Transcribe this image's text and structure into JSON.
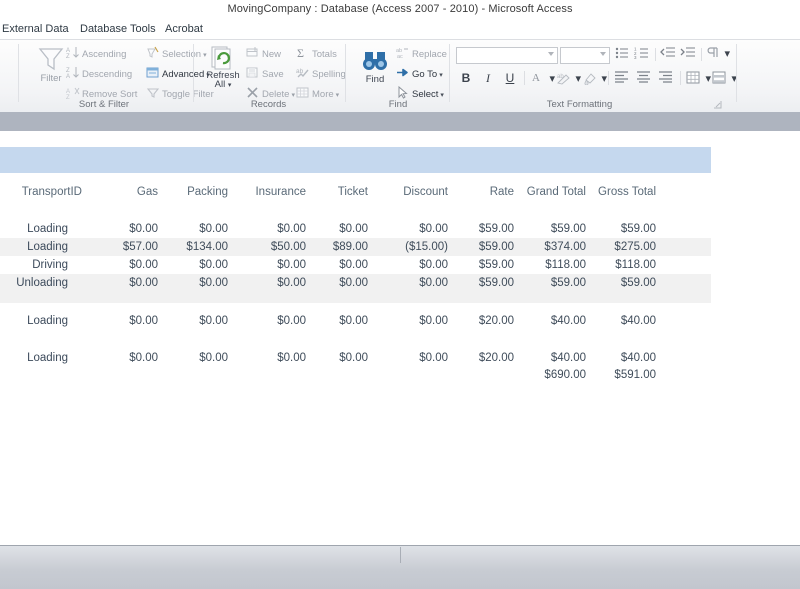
{
  "window": {
    "title": "MovingCompany : Database (Access 2007 - 2010)  -  Microsoft Access"
  },
  "ribbon": {
    "tabs": [
      {
        "label": "External Data",
        "active": false
      },
      {
        "label": "Database Tools",
        "active": false
      },
      {
        "label": "Acrobat",
        "active": false
      }
    ],
    "groups": [
      {
        "name": "Sort & Filter",
        "label": "Sort & Filter",
        "big": [
          {
            "label": "Filter",
            "icon": "funnel-icon",
            "enabled": false
          }
        ],
        "items": [
          {
            "label": "Ascending",
            "icon": "sort-ascending-icon",
            "enabled": false,
            "dropdown": false
          },
          {
            "label": "Descending",
            "icon": "sort-descending-icon",
            "enabled": false,
            "dropdown": false
          },
          {
            "label": "Remove Sort",
            "icon": "remove-sort-icon",
            "enabled": false,
            "dropdown": false
          },
          {
            "label": "Selection",
            "icon": "selection-icon",
            "enabled": false,
            "dropdown": true
          },
          {
            "label": "Advanced",
            "icon": "advanced-filter-icon",
            "enabled": true,
            "dropdown": true
          },
          {
            "label": "Toggle Filter",
            "icon": "toggle-filter-icon",
            "enabled": false,
            "dropdown": false
          }
        ]
      },
      {
        "name": "Records",
        "label": "Records",
        "big": [
          {
            "label": "Refresh All",
            "icon": "refresh-all-icon",
            "enabled": true
          }
        ],
        "items": [
          {
            "label": "New",
            "icon": "new-record-icon",
            "enabled": false,
            "dropdown": false
          },
          {
            "label": "Save",
            "icon": "save-record-icon",
            "enabled": false,
            "dropdown": false
          },
          {
            "label": "Delete",
            "icon": "delete-record-icon",
            "enabled": false,
            "dropdown": true
          },
          {
            "label": "Totals",
            "icon": "sigma-totals-icon",
            "enabled": false,
            "dropdown": false
          },
          {
            "label": "Spelling",
            "icon": "spelling-icon",
            "enabled": false,
            "dropdown": false
          },
          {
            "label": "More",
            "icon": "more-icon",
            "enabled": false,
            "dropdown": true
          }
        ]
      },
      {
        "name": "Find",
        "label": "Find",
        "big": [
          {
            "label": "Find",
            "icon": "binoculars-find-icon",
            "enabled": true
          }
        ],
        "items": [
          {
            "label": "Replace",
            "icon": "replace-icon",
            "enabled": false,
            "dropdown": false
          },
          {
            "label": "Go To",
            "icon": "go-to-icon",
            "enabled": true,
            "dropdown": true
          },
          {
            "label": "Select",
            "icon": "select-icon",
            "enabled": true,
            "dropdown": true
          }
        ]
      },
      {
        "name": "Text Formatting",
        "label": "Text Formatting",
        "font_name": "",
        "font_size": "",
        "buttons": [
          {
            "name": "bullets-icon",
            "glyph": "bullets"
          },
          {
            "name": "numbering-icon",
            "glyph": "numbering"
          },
          {
            "name": "decrease-indent-icon",
            "glyph": "outdent"
          },
          {
            "name": "increase-indent-icon",
            "glyph": "indent"
          },
          {
            "name": "text-direction-icon",
            "glyph": "rtl"
          },
          {
            "name": "bold-icon",
            "glyph": "B"
          },
          {
            "name": "italic-icon",
            "glyph": "I"
          },
          {
            "name": "underline-icon",
            "glyph": "U"
          },
          {
            "name": "font-color-icon",
            "glyph": "A"
          },
          {
            "name": "text-highlight-icon",
            "glyph": "highlight"
          },
          {
            "name": "background-color-icon",
            "glyph": "fill"
          },
          {
            "name": "align-left-icon",
            "glyph": "align-left"
          },
          {
            "name": "align-center-icon",
            "glyph": "align-center"
          },
          {
            "name": "align-right-icon",
            "glyph": "align-right"
          },
          {
            "name": "gridlines-icon",
            "glyph": "grid"
          },
          {
            "name": "alternate-fill-color-icon",
            "glyph": "altfill"
          }
        ]
      }
    ]
  },
  "report": {
    "columns": [
      {
        "key": "transport_id",
        "label": "TransportID",
        "align": "right"
      },
      {
        "key": "gas",
        "label": "Gas",
        "align": "right"
      },
      {
        "key": "packing",
        "label": "Packing",
        "align": "right"
      },
      {
        "key": "insurance",
        "label": "Insurance",
        "align": "right"
      },
      {
        "key": "ticket",
        "label": "Ticket",
        "align": "right"
      },
      {
        "key": "discount",
        "label": "Discount",
        "align": "right"
      },
      {
        "key": "rate",
        "label": "Rate",
        "align": "right"
      },
      {
        "key": "grand_total",
        "label": "Grand Total",
        "align": "right"
      },
      {
        "key": "gross_total",
        "label": "Gross Total",
        "align": "right"
      }
    ],
    "rows": [
      {
        "transport_id": "Loading",
        "gas": "$0.00",
        "packing": "$0.00",
        "insurance": "$0.00",
        "ticket": "$0.00",
        "discount": "$0.00",
        "rate": "$59.00",
        "grand_total": "$59.00",
        "gross_total": "$59.00",
        "shaded": false
      },
      {
        "transport_id": "Loading",
        "gas": "$57.00",
        "packing": "$134.00",
        "insurance": "$50.00",
        "ticket": "$89.00",
        "discount": "($15.00)",
        "rate": "$59.00",
        "grand_total": "$374.00",
        "gross_total": "$275.00",
        "shaded": true
      },
      {
        "transport_id": "Driving",
        "gas": "$0.00",
        "packing": "$0.00",
        "insurance": "$0.00",
        "ticket": "$0.00",
        "discount": "$0.00",
        "rate": "$59.00",
        "grand_total": "$118.00",
        "gross_total": "$118.00",
        "shaded": false
      },
      {
        "transport_id": "Unloading",
        "gas": "$0.00",
        "packing": "$0.00",
        "insurance": "$0.00",
        "ticket": "$0.00",
        "discount": "$0.00",
        "rate": "$59.00",
        "grand_total": "$59.00",
        "gross_total": "$59.00",
        "shaded": true
      },
      {
        "transport_id": "Loading",
        "gas": "$0.00",
        "packing": "$0.00",
        "insurance": "$0.00",
        "ticket": "$0.00",
        "discount": "$0.00",
        "rate": "$20.00",
        "grand_total": "$40.00",
        "gross_total": "$40.00",
        "shaded": false
      },
      {
        "transport_id": "Loading",
        "gas": "$0.00",
        "packing": "$0.00",
        "insurance": "$0.00",
        "ticket": "$0.00",
        "discount": "$0.00",
        "rate": "$20.00",
        "grand_total": "$40.00",
        "gross_total": "$40.00",
        "shaded": false
      }
    ],
    "totals": {
      "grand_total": "$690.00",
      "gross_total": "$591.00"
    }
  },
  "colors": {
    "header_band": "#c5d8ee",
    "gray_band": "#aeb4bf",
    "row_shade": "#f1f1f1",
    "text": "#3f4c5a",
    "header_text": "#5a6a78"
  }
}
